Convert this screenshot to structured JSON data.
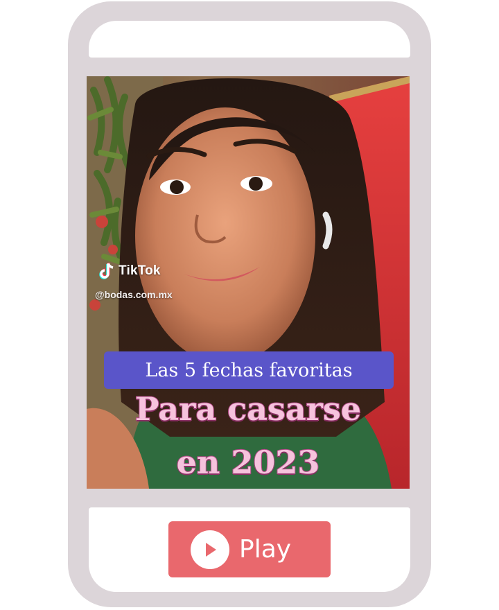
{
  "video": {
    "watermark_brand": "TikTok",
    "watermark_handle": "@bodas.com.mx",
    "caption_box": "Las 5 fechas favoritas",
    "headline_line1": "Para casarse",
    "headline_line2": "en 2023"
  },
  "controls": {
    "play_label": "Play",
    "play_icon": "play-icon"
  },
  "colors": {
    "phone_frame": "#dcd5d9",
    "caption_box_bg": "#5a55c9",
    "headline_fill": "#f6c3dd",
    "headline_stroke": "#b54b8a",
    "play_button_bg": "#e9686d"
  }
}
